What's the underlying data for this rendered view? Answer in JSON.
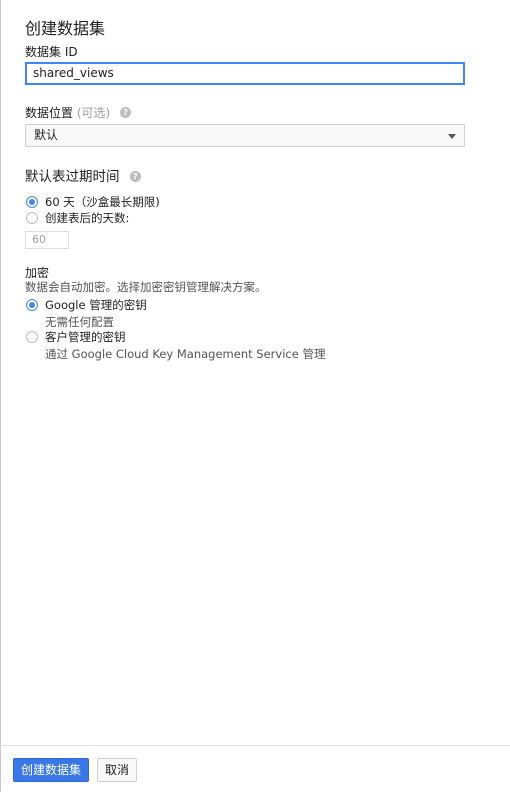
{
  "title": "创建数据集",
  "dataset_id": {
    "label": "数据集 ID",
    "value": "shared_views"
  },
  "location": {
    "label": "数据位置",
    "optional": "(可选)",
    "selected": "默认"
  },
  "expiration": {
    "title": "默认表过期时间",
    "option_never": "60 天（沙盒最长期限)",
    "option_days": "创建表后的天数:",
    "days_placeholder": "60"
  },
  "encryption": {
    "title": "加密",
    "description": "数据会自动加密。选择加密密钥管理解决方案。",
    "google_label": "Google 管理的密钥",
    "google_desc": "无需任何配置",
    "customer_label": "客户管理的密钥",
    "customer_desc": "通过 Google Cloud Key Management Service 管理"
  },
  "footer": {
    "create_label": "创建数据集",
    "cancel_label": "取消"
  },
  "colors": {
    "accent": "#4285f4",
    "primary_button": "#3b78e7"
  }
}
